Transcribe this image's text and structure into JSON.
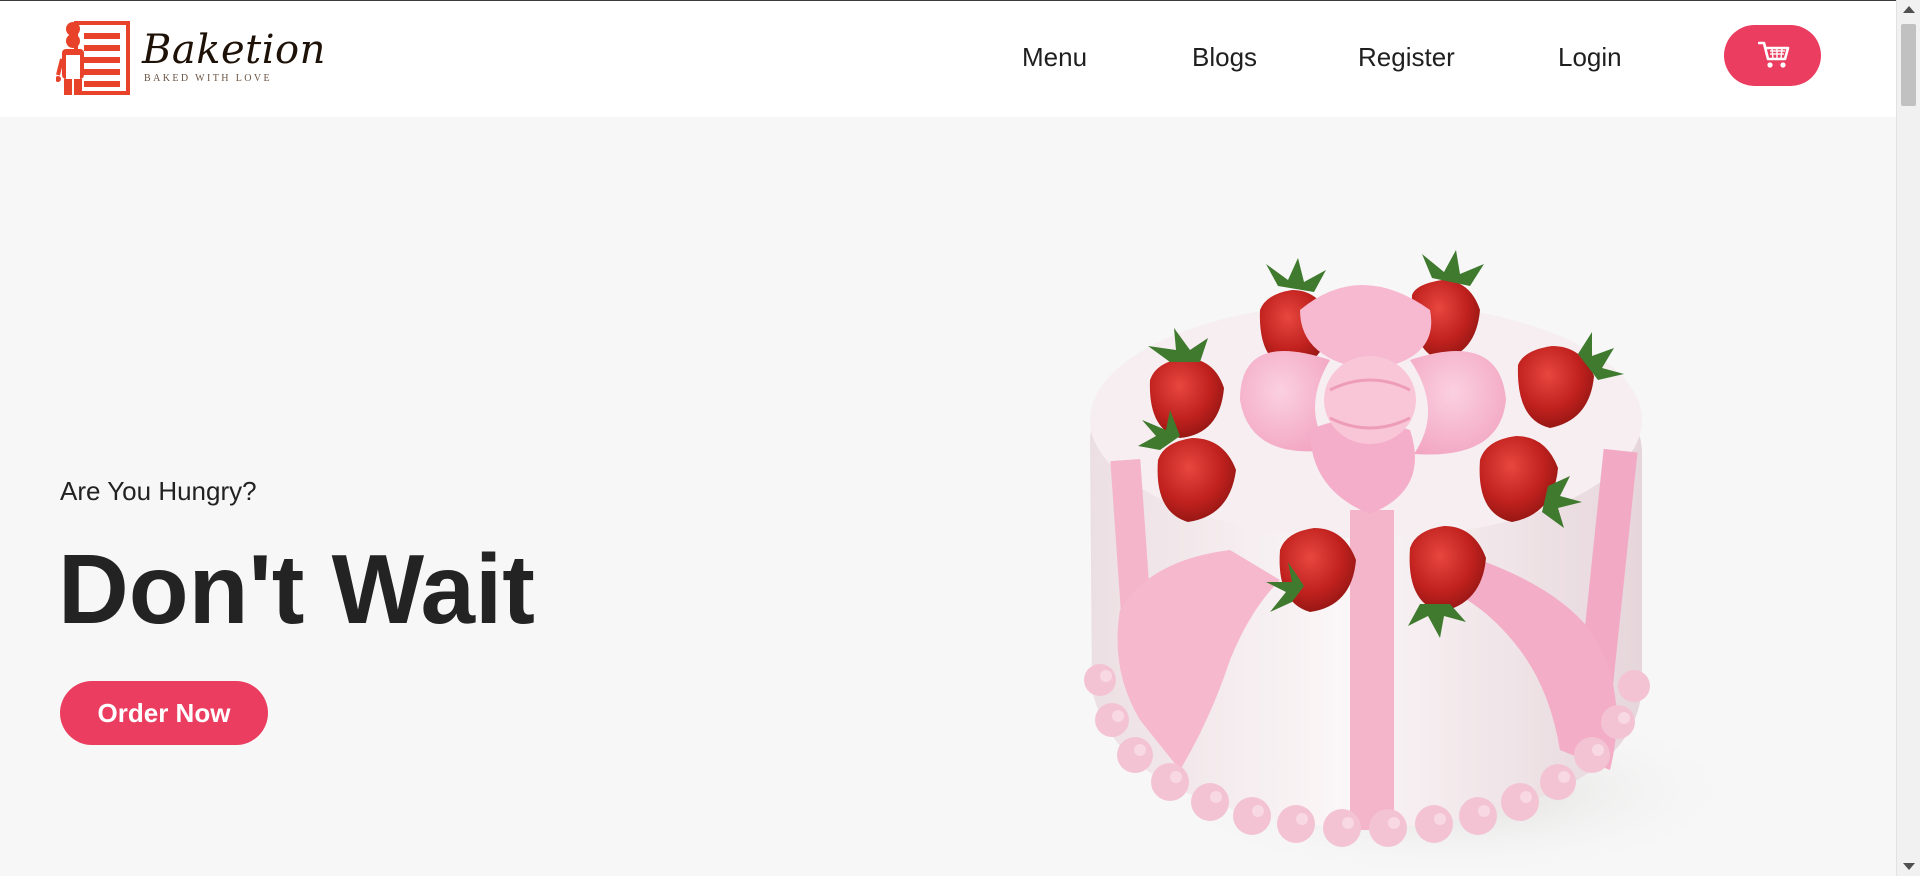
{
  "brand": {
    "name": "Baketion",
    "tagline": "BAKED WITH LOVE",
    "logo_icon": "chef-with-oven-icon"
  },
  "nav": {
    "items": [
      {
        "label": "Menu"
      },
      {
        "label": "Blogs"
      },
      {
        "label": "Register"
      },
      {
        "label": "Login"
      }
    ],
    "cart_icon": "shopping-cart-icon"
  },
  "hero": {
    "eyebrow": "Are You Hungry?",
    "title": "Don't Wait",
    "cta_label": "Order Now",
    "image": "strawberry-cake-with-pink-bow"
  },
  "colors": {
    "accent": "#ea3d5f",
    "header_bg": "#ffffff",
    "hero_bg": "#f7f7f7",
    "text_dark": "#232323"
  }
}
